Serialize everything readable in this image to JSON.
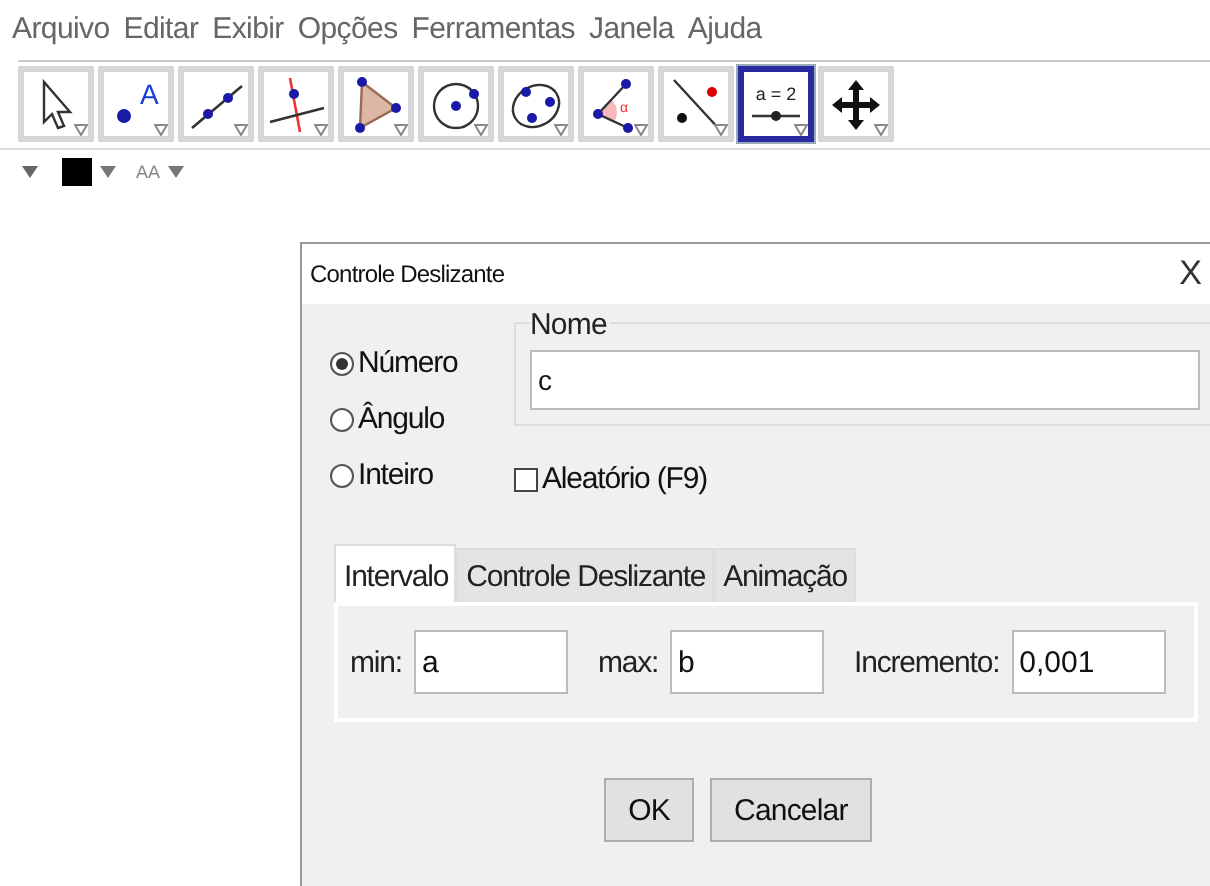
{
  "menu": [
    "Arquivo",
    "Editar",
    "Exibir",
    "Opções",
    "Ferramentas",
    "Janela",
    "Ajuda"
  ],
  "toolbar": {
    "tools": [
      {
        "kind": "move",
        "selected": false
      },
      {
        "kind": "point",
        "label": "A",
        "selected": false
      },
      {
        "kind": "line",
        "selected": false
      },
      {
        "kind": "perpendicular",
        "selected": false
      },
      {
        "kind": "polygon",
        "selected": false
      },
      {
        "kind": "circle",
        "selected": false
      },
      {
        "kind": "conic",
        "selected": false
      },
      {
        "kind": "angle",
        "label": "α",
        "selected": false
      },
      {
        "kind": "reflect",
        "selected": false
      },
      {
        "kind": "slider",
        "label": "a = 2",
        "selected": true
      },
      {
        "kind": "pan",
        "selected": false
      }
    ]
  },
  "style_bar": {
    "font_size_label": "AA"
  },
  "dialog": {
    "title": "Controle Deslizante",
    "close": "X",
    "types": [
      {
        "label": "Número",
        "selected": true
      },
      {
        "label": "Ângulo",
        "selected": false
      },
      {
        "label": "Inteiro",
        "selected": false
      }
    ],
    "name_group": {
      "legend": "Nome",
      "value": "c"
    },
    "random": {
      "label": "Aleatório (F9)",
      "checked": false
    },
    "tabs": [
      {
        "label": "Intervalo",
        "selected": true
      },
      {
        "label": "Controle Deslizante",
        "selected": false
      },
      {
        "label": "Animação",
        "selected": false
      }
    ],
    "fields": [
      {
        "label": "min:",
        "value": "a"
      },
      {
        "label": "max:",
        "value": "b"
      },
      {
        "label": "Incremento:",
        "value": "0,001"
      }
    ],
    "buttons": [
      "OK",
      "Cancelar"
    ]
  }
}
